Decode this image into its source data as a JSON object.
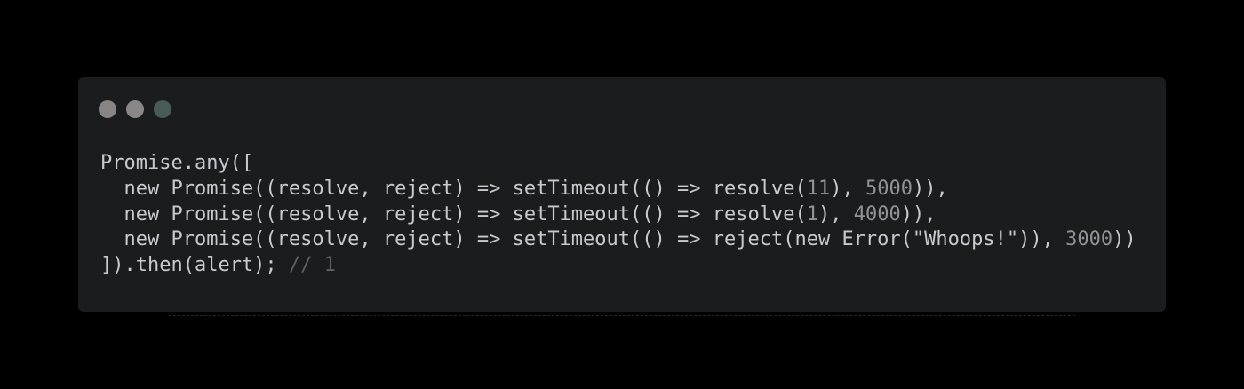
{
  "window": {
    "controls": [
      {
        "name": "close",
        "color": "#8a8585"
      },
      {
        "name": "minimize",
        "color": "#8b8786"
      },
      {
        "name": "zoom",
        "color": "#485b58"
      }
    ]
  },
  "code": {
    "lines": [
      [
        {
          "t": "Promise.any([",
          "k": "plain"
        }
      ],
      [
        {
          "t": "  new Promise((resolve, reject) => setTimeout(() => resolve(",
          "k": "plain"
        },
        {
          "t": "11",
          "k": "num"
        },
        {
          "t": "), ",
          "k": "plain"
        },
        {
          "t": "5000",
          "k": "num"
        },
        {
          "t": ")),",
          "k": "plain"
        }
      ],
      [
        {
          "t": "  new Promise((resolve, reject) => setTimeout(() => resolve(",
          "k": "plain"
        },
        {
          "t": "1",
          "k": "num"
        },
        {
          "t": "), ",
          "k": "plain"
        },
        {
          "t": "4000",
          "k": "num"
        },
        {
          "t": ")),",
          "k": "plain"
        }
      ],
      [
        {
          "t": "  new Promise((resolve, reject) => setTimeout(() => reject(new Error(",
          "k": "plain"
        },
        {
          "t": "\"Whoops!\"",
          "k": "str"
        },
        {
          "t": ")), ",
          "k": "plain"
        },
        {
          "t": "3000",
          "k": "num"
        },
        {
          "t": "))",
          "k": "plain"
        }
      ],
      [
        {
          "t": "]).then(alert); ",
          "k": "plain"
        },
        {
          "t": "// 1",
          "k": "com"
        }
      ]
    ]
  }
}
